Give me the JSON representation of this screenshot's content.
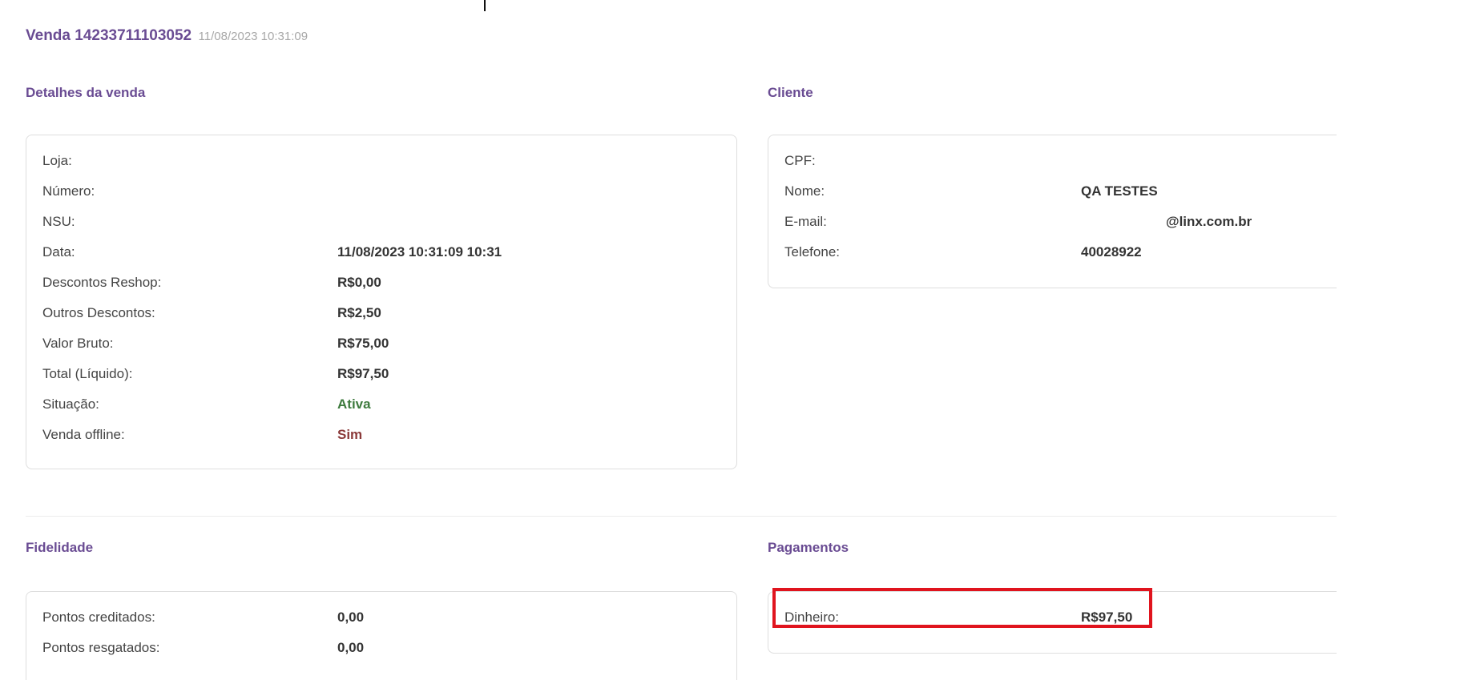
{
  "sale": {
    "title": "Venda 14233711103052",
    "datetime": "11/08/2023 10:31:09"
  },
  "sections": {
    "details_title": "Detalhes da venda",
    "client_title": "Cliente",
    "loyalty_title": "Fidelidade",
    "payments_title": "Pagamentos"
  },
  "details": [
    {
      "label": "Loja:",
      "value": ""
    },
    {
      "label": "Número:",
      "value": ""
    },
    {
      "label": "NSU:",
      "value": ""
    },
    {
      "label": "Data:",
      "value": "11/08/2023 10:31:09 10:31"
    },
    {
      "label": "Descontos Reshop:",
      "value": "R$0,00"
    },
    {
      "label": "Outros Descontos:",
      "value": "R$2,50"
    },
    {
      "label": "Valor Bruto:",
      "value": "R$75,00"
    },
    {
      "label": "Total (Líquido):",
      "value": "R$97,50"
    },
    {
      "label": "Situação:",
      "value": "Ativa",
      "color": "#3d7a3d"
    },
    {
      "label": "Venda offline:",
      "value": "Sim",
      "color": "#8b3a3a"
    }
  ],
  "client": [
    {
      "label": "CPF:",
      "value": ""
    },
    {
      "label": "Nome:",
      "value": "QA TESTES"
    },
    {
      "label": "E-mail:",
      "value": "@linx.com.br"
    },
    {
      "label": "Telefone:",
      "value": "40028922"
    }
  ],
  "loyalty": [
    {
      "label": "Pontos creditados:",
      "value": "0,00"
    },
    {
      "label": "Pontos resgatados:",
      "value": "0,00"
    }
  ],
  "payments": [
    {
      "label": "Dinheiro:",
      "value": "R$97,50"
    }
  ],
  "colors": {
    "accent": "#6a4c93",
    "highlight": "#e0141e"
  }
}
